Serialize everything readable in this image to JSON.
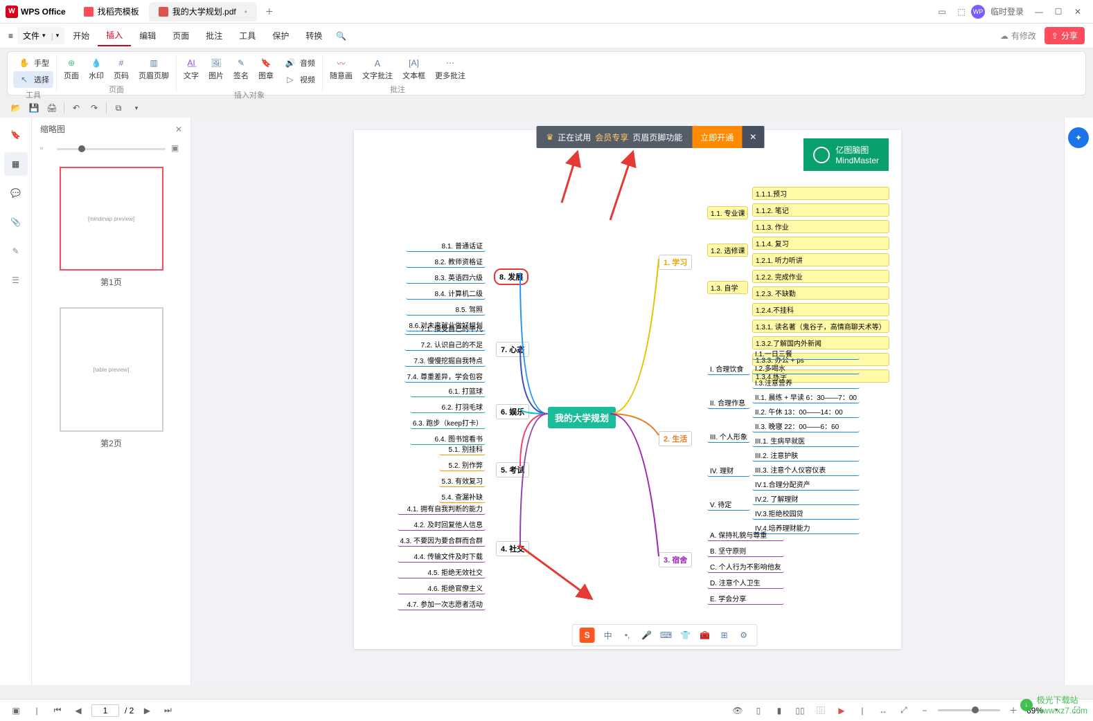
{
  "titlebar": {
    "app": "WPS Office",
    "tabs": [
      {
        "label": "找稻壳模板",
        "iconColor": "#fd4c5b"
      },
      {
        "label": "我的大学规划.pdf",
        "iconColor": "#d9534f"
      }
    ],
    "login": "临时登录"
  },
  "menubar": {
    "file": "文件",
    "items": [
      "开始",
      "插入",
      "编辑",
      "页面",
      "批注",
      "工具",
      "保护",
      "转换"
    ],
    "active": "插入",
    "pending": "有修改",
    "share": "分享"
  },
  "ribbon": {
    "group1": {
      "hand": "手型",
      "select": "选择",
      "label": "工具"
    },
    "group2": {
      "page": "页面",
      "watermark": "水印",
      "pagenum": "页码",
      "headerfooter": "页眉页脚",
      "label": "页面"
    },
    "group3": {
      "text": "文字",
      "image": "图片",
      "sign": "签名",
      "stamp": "图章",
      "audio": "音频",
      "video": "视频",
      "label": "插入对象"
    },
    "group4": {
      "free": "随意画",
      "textnote": "文字批注",
      "textbox": "文本框",
      "more": "更多批注",
      "label": "批注"
    }
  },
  "sidebar": {
    "title": "缩略图",
    "p1": "第1页",
    "p2": "第2页"
  },
  "banner": {
    "pre": "正在试用",
    "gold": "会员专享",
    "post": "页眉页脚功能",
    "btn": "立即开通"
  },
  "brand": {
    "name": "亿图脑图",
    "en": "MindMaster"
  },
  "mindmap": {
    "center": "我的大学规划",
    "right_branches": [
      "1. 学习",
      "2. 生活",
      "3. 宿舍"
    ],
    "left_branches": [
      "8. 发展",
      "7. 心态",
      "6. 娱乐",
      "5. 考试",
      "4. 社交"
    ],
    "r_study": [
      "1.1. 专业课",
      "1.2. 选修课",
      "1.3. 自学"
    ],
    "r_study_leaf": [
      "1.1.1.预习",
      "1.1.2. 笔记",
      "1.1.3. 作业",
      "1.1.4. 复习",
      "1.2.1. 听力听讲",
      "1.2.2. 完成作业",
      "1.2.3. 不缺勤",
      "1.2.4.不挂科",
      "1.3.1. 读名著（鬼谷子，高情商聊天术等）",
      "1.3.2.了解国内外新闻",
      "1.3.3. 办公 + ps",
      "1.3.4.练字"
    ],
    "r_life": [
      "I. 合理饮食",
      "II. 合理作息",
      "III. 个人形象",
      "IV. 理财",
      "V. 待定"
    ],
    "r_life_leaf": [
      "I.1.一日三餐",
      "I.2.多喝水",
      "I.3.注意营养",
      "II.1. 晨练 + 早读 6：30——7：00",
      "II.2. 午休  13：00——14：00",
      "II.3. 晚寝  22：00——6：60",
      "III.1. 生病早就医",
      "III.2. 注意护肤",
      "III.3. 注意个人仪容仪表",
      "IV.1.合理分配资产",
      "IV.2. 了解理财",
      "IV.3.拒绝校园贷",
      "IV.4.培养理财能力"
    ],
    "r_dorm": [
      "A. 保持礼貌与尊重",
      "B. 坚守原则",
      "C. 个人行为不影响他友",
      "D. 注意个人卫生",
      "E. 学会分享"
    ],
    "l_dev": [
      "8.1. 普通话证",
      "8.2. 教师资格证",
      "8.3. 英语四六级",
      "8.4. 计算机二级",
      "8.5. 驾照",
      "8.6.对未来就业做好规划"
    ],
    "l_mind": [
      "7.1. 接受自己的平凡",
      "7.2. 认识自己的不足",
      "7.3. 慢慢挖掘自我特点",
      "7.4. 尊重差异，学会包容"
    ],
    "l_ent": [
      "6.1. 打篮球",
      "6.2. 打羽毛球",
      "6.3. 跑步（keep打卡）",
      "6.4. 图书馆看书"
    ],
    "l_exam": [
      "5.1. 别挂科",
      "5.2. 别作弊",
      "5.3. 有效复习",
      "5.4. 查漏补缺"
    ],
    "l_soc": [
      "4.1. 拥有自我判断的能力",
      "4.2. 及时回复他人信息",
      "4.3. 不要因为要合群而合群",
      "4.4. 传输文件及时下载",
      "4.5. 拒绝无效社交",
      "4.6. 拒绝官僚主义",
      "4.7. 参加一次志愿者活动"
    ]
  },
  "status": {
    "page": "1",
    "total": "/ 2",
    "zoom": "69%"
  },
  "watermark": {
    "name": "极光下载站",
    "url": "www.xz7.com"
  }
}
